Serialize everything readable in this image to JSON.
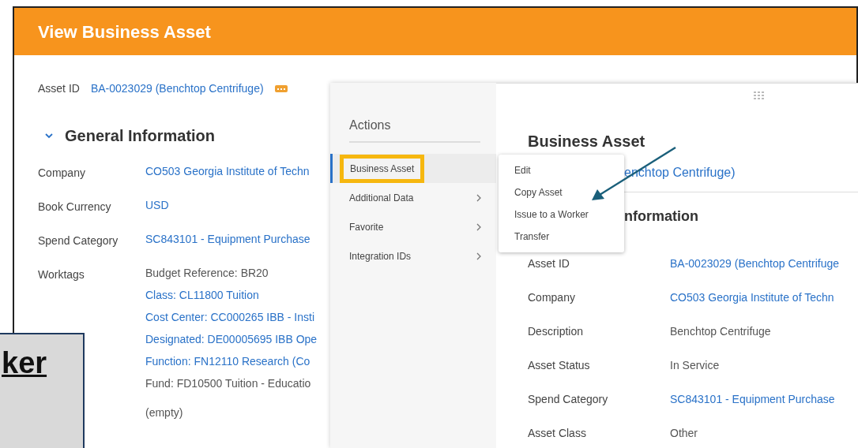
{
  "header": {
    "title": "View Business Asset"
  },
  "asset_id": {
    "label": "Asset ID",
    "value": "BA-0023029 (Benchtop Centrifuge)"
  },
  "section": {
    "title": "General Information",
    "expanded": true
  },
  "fields": [
    {
      "label": "Company",
      "values": [
        {
          "text": "CO503 Georgia Institute of Techn",
          "link": true
        }
      ]
    },
    {
      "label": "Book Currency",
      "values": [
        {
          "text": "USD",
          "link": true
        }
      ]
    },
    {
      "label": "Spend Category",
      "values": [
        {
          "text": "SC843101 - Equipment Purchase",
          "link": true
        }
      ]
    },
    {
      "label": "Worktags",
      "values": [
        {
          "text": "Budget Reference: BR20",
          "link": false
        },
        {
          "text": "Class: CL11800 Tuition",
          "link": true
        },
        {
          "text": "Cost Center: CC000265 IBB - Insti",
          "link": true
        },
        {
          "text": "Designated: DE00005695 IBB Ope",
          "link": true
        },
        {
          "text": "Function: FN12110 Research (Co",
          "link": true
        },
        {
          "text": "Fund: FD10500 Tuition - Educatio",
          "link": false
        }
      ]
    },
    {
      "values": [
        {
          "text": "(empty)",
          "link": false
        }
      ]
    }
  ],
  "actions_menu": {
    "title": "Actions",
    "items": [
      {
        "label": "Business Asset",
        "selected": true,
        "has_submenu": false
      },
      {
        "label": "Additional Data",
        "selected": false,
        "has_submenu": true
      },
      {
        "label": "Favorite",
        "selected": false,
        "has_submenu": true
      },
      {
        "label": "Integration IDs",
        "selected": false,
        "has_submenu": true
      }
    ]
  },
  "submenu": {
    "items": [
      "Edit",
      "Copy Asset",
      "Issue to a Worker",
      "Transfer"
    ]
  },
  "detail_panel": {
    "title": "Business Asset",
    "subtitle_fragment": "enchtop Centrifuge)",
    "section_fragment": "nformation",
    "rows": [
      {
        "label": "Asset ID",
        "value": "BA-0023029 (Benchtop Centrifuge",
        "link": true
      },
      {
        "label": "Company",
        "value": "CO503 Georgia Institute of Techn",
        "link": true
      },
      {
        "label": "Description",
        "value": "Benchtop Centrifuge",
        "link": false
      },
      {
        "label": "Asset Status",
        "value": "In Service",
        "link": false
      },
      {
        "label": "Spend Category",
        "value": "SC843101 - Equipment Purchase",
        "link": true
      },
      {
        "label": "Asset Class",
        "value": "Other",
        "link": false
      }
    ]
  },
  "callout": {
    "text": "ker"
  }
}
